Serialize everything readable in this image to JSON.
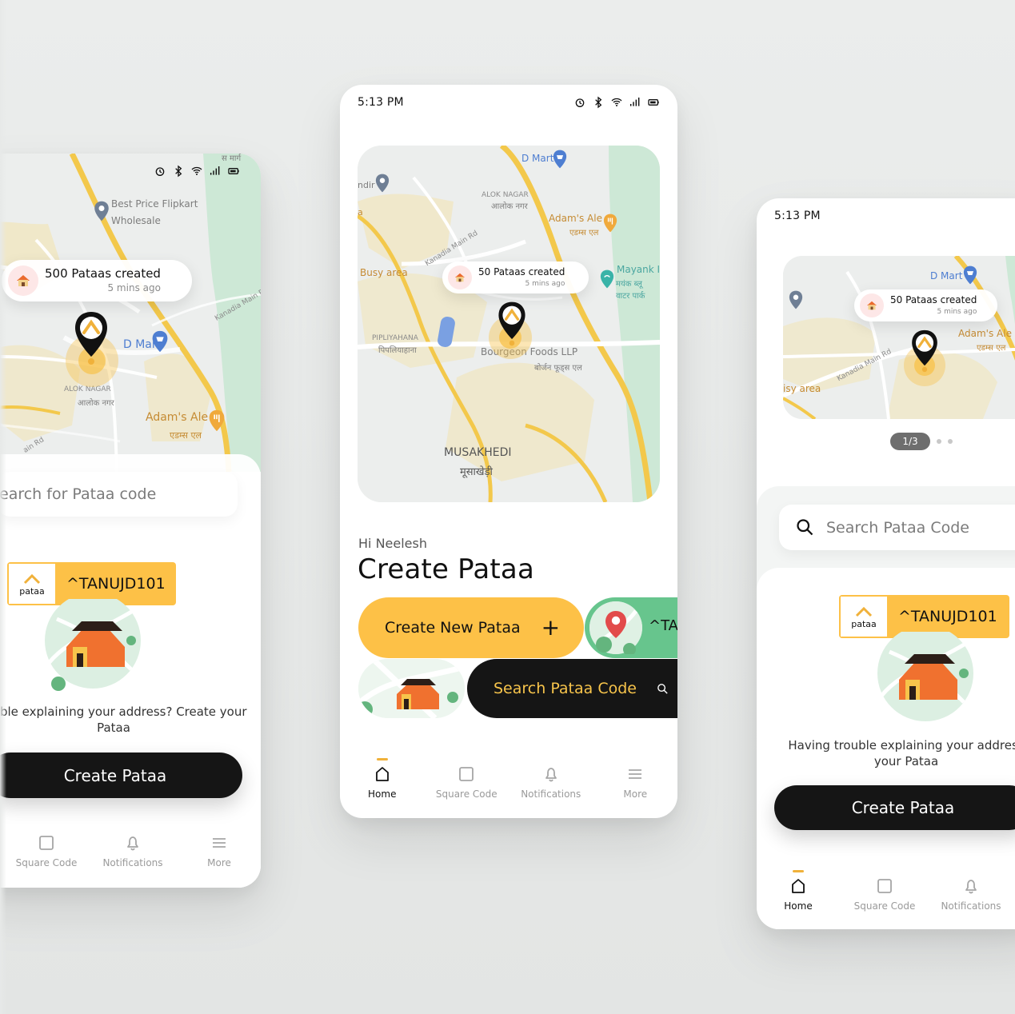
{
  "colors": {
    "accent_yellow": "#fdc147",
    "dark": "#151515",
    "green": "#67c58d",
    "map_road": "#f3c84b",
    "map_green": "#cde8d6"
  },
  "left_phone": {
    "status_icons": [
      "alarm-icon",
      "bluetooth-icon",
      "wifi-icon",
      "signal-icon",
      "battery-icon"
    ],
    "map": {
      "labels": {
        "best_price": "Best Price Flipkart",
        "wholesale": "Wholesale",
        "d_mart": "D Mart",
        "alok_nagar": "ALOK NAGAR",
        "alok_nagar_hi": "आलोक नगर",
        "adams_ale": "Adam's Ale",
        "adams_ale_hi": "एडम्स एल",
        "kanadia": "Kanadia Main R",
        "main_rd": "ain Rd",
        "top_hi": "स मार्ग"
      }
    },
    "callout": {
      "title": "500 Pataas created",
      "sub": "5 mins ago"
    },
    "search": {
      "text": "earch for Pataa code"
    },
    "badge": {
      "brand": "pataa",
      "code": "^TANUJD101"
    },
    "helper": "rouble explaining your address? Create your Pataa",
    "cta": "Create Pataa",
    "nav": [
      {
        "label": "Square Code"
      },
      {
        "label": "Notifications"
      },
      {
        "label": "More"
      }
    ]
  },
  "center_phone": {
    "time": "5:13 PM",
    "status_icons": [
      "alarm-icon",
      "bluetooth-icon",
      "wifi-icon",
      "signal-icon",
      "battery-icon"
    ],
    "map": {
      "labels": {
        "d_mart": "D Mart",
        "alok_nagar": "ALOK NAGAR",
        "alok_nagar_hi": "आलोक नगर",
        "adams_ale": "Adam's Ale",
        "adams_ale_hi": "एडम्स एल",
        "busy_area": "Busy area",
        "mayank": "Mayank I",
        "mayank_hi1": "मयंक ब्लू",
        "mayank_hi2": "वाटर पार्क",
        "kanadia": "Kanadia Main Rd",
        "bourgeon": "Bourgeon Foods LLP",
        "bourgeon_hi": "बोर्जन फूड्स एल",
        "piplyahana": "PIPLIYAHANA",
        "piplyahana_hi": "पिपलियाहाना",
        "musakhedi": "MUSAKHEDI",
        "musakhedi_hi": "मूसाखेड़ी",
        "ndir": "ndir",
        "a": "a"
      }
    },
    "callout": {
      "title": "50 Pataas created",
      "sub": "5 mins ago"
    },
    "greeting": "Hi Neelesh",
    "title": "Create Pataa",
    "create_new": "Create New Pataa",
    "create_new_icon": "+",
    "green_code": "^TAI",
    "search_btn": "Search Pataa Code",
    "nav": [
      {
        "label": "Home"
      },
      {
        "label": "Square Code"
      },
      {
        "label": "Notifications"
      },
      {
        "label": "More"
      }
    ]
  },
  "right_phone": {
    "time": "5:13 PM",
    "status_icons": [
      "alarm-icon",
      "bluetooth-icon"
    ],
    "map": {
      "labels": {
        "d_mart": "D Mart",
        "adams_ale": "Adam's Ale",
        "adams_ale_hi": "एडम्स एल",
        "kanadia": "Kanadia Main Rd",
        "busy_area": "isy area"
      }
    },
    "callout": {
      "title": "50 Pataas created",
      "sub": "5 mins ago"
    },
    "pager": {
      "current": "1/3"
    },
    "search": {
      "text": "Search Pataa Code"
    },
    "badge": {
      "brand": "pataa",
      "code": "^TANUJD101"
    },
    "helper": "Having trouble explaining your address your Pataa",
    "cta": "Create Pataa",
    "nav": [
      {
        "label": "Home"
      },
      {
        "label": "Square Code"
      },
      {
        "label": "Notifications"
      }
    ]
  }
}
